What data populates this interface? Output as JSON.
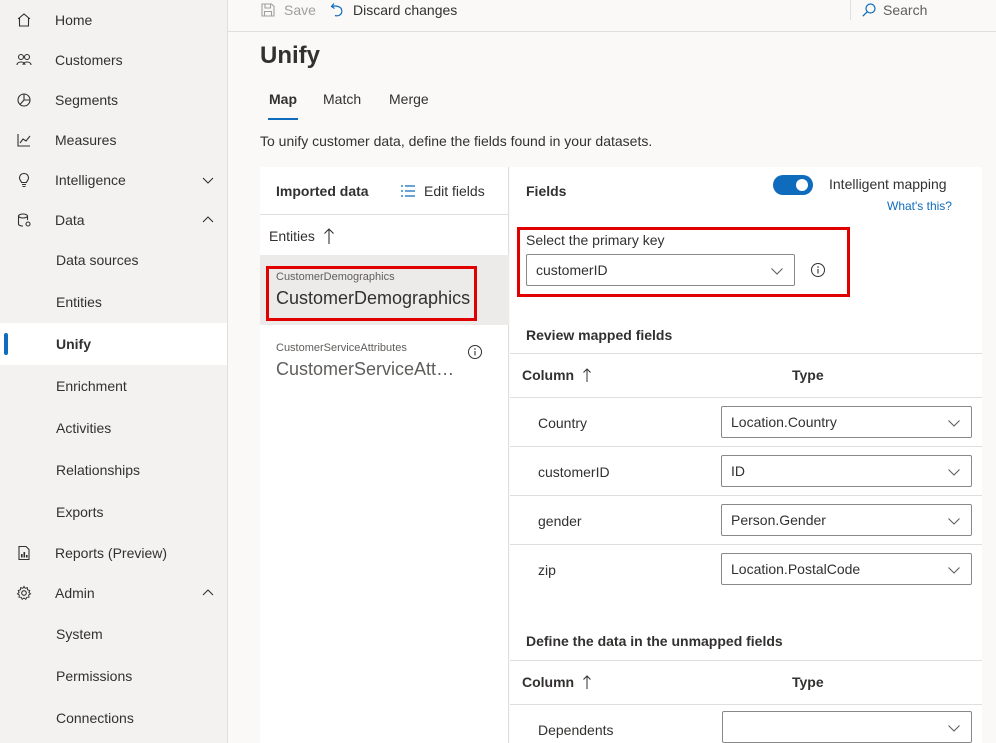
{
  "commandbar": {
    "save_label": "Save",
    "discard_label": "Discard changes",
    "search_label": "Search"
  },
  "sidebar": {
    "items": [
      {
        "label": "Home",
        "icon": "home-icon"
      },
      {
        "label": "Customers",
        "icon": "people-icon"
      },
      {
        "label": "Segments",
        "icon": "segments-icon"
      },
      {
        "label": "Measures",
        "icon": "chart-icon"
      },
      {
        "label": "Intelligence",
        "icon": "lightbulb-icon",
        "expandable": true,
        "expanded": false
      },
      {
        "label": "Data",
        "icon": "database-icon",
        "expandable": true,
        "expanded": true
      },
      {
        "label": "Reports (Preview)",
        "icon": "report-icon"
      },
      {
        "label": "Admin",
        "icon": "gear-icon",
        "expandable": true,
        "expanded": true
      }
    ],
    "data_children": [
      "Data sources",
      "Entities",
      "Unify",
      "Enrichment",
      "Activities",
      "Relationships",
      "Exports"
    ],
    "admin_children": [
      "System",
      "Permissions",
      "Connections"
    ],
    "active": "Unify"
  },
  "page": {
    "title": "Unify",
    "tabs": [
      "Map",
      "Match",
      "Merge"
    ],
    "active_tab": "Map",
    "intro": "To unify customer data, define the fields found in your datasets."
  },
  "imported": {
    "header": "Imported data",
    "edit_fields": "Edit fields",
    "entities_header": "Entities",
    "entities": [
      {
        "small": "CustomerDemographics",
        "big": "CustomerDemographics",
        "selected": true
      },
      {
        "small": "CustomerServiceAttributes",
        "big": "CustomerServiceAttributes",
        "selected": false
      }
    ]
  },
  "fields": {
    "header": "Fields",
    "intelligent_mapping_label": "Intelligent mapping",
    "intelligent_mapping_on": true,
    "whats_this": "What's this?",
    "primary_key_label": "Select the primary key",
    "primary_key_value": "customerID",
    "review_header": "Review mapped fields",
    "column_header": "Column",
    "type_header": "Type",
    "mapped": [
      {
        "column": "Country",
        "type": "Location.Country"
      },
      {
        "column": "customerID",
        "type": "ID"
      },
      {
        "column": "gender",
        "type": "Person.Gender"
      },
      {
        "column": "zip",
        "type": "Location.PostalCode"
      }
    ],
    "unmapped_header": "Define the data in the unmapped fields",
    "unmapped": [
      {
        "column": "Dependents",
        "type": ""
      }
    ]
  },
  "colors": {
    "accent": "#0f6cbd",
    "highlight_box": "#e00000"
  }
}
